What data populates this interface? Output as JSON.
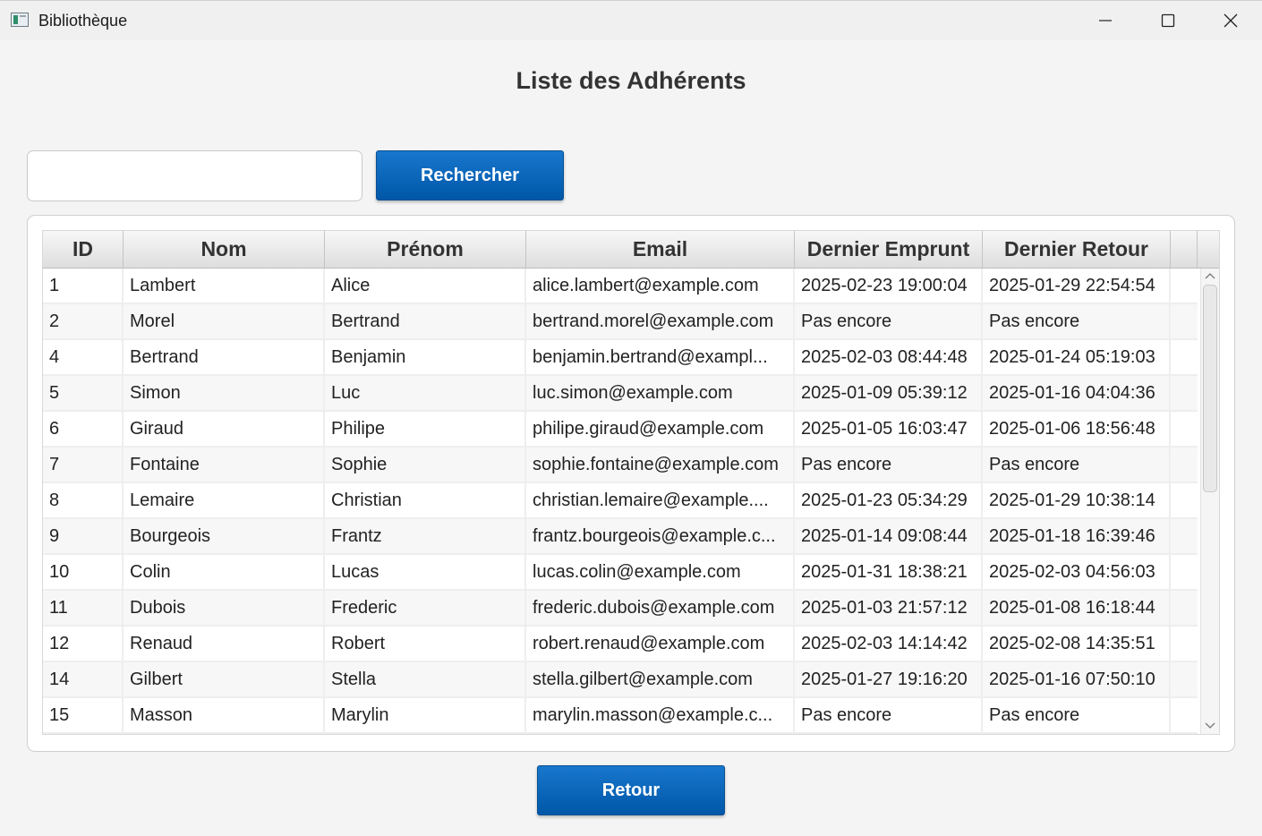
{
  "window": {
    "title": "Bibliothèque"
  },
  "page": {
    "heading": "Liste des Adhérents"
  },
  "search": {
    "value": "",
    "placeholder": "",
    "button_label": "Rechercher"
  },
  "table": {
    "columns": [
      "ID",
      "Nom",
      "Prénom",
      "Email",
      "Dernier Emprunt",
      "Dernier Retour"
    ],
    "rows": [
      [
        "1",
        "Lambert",
        "Alice",
        "alice.lambert@example.com",
        "2025-02-23 19:00:04",
        "2025-01-29 22:54:54"
      ],
      [
        "2",
        "Morel",
        "Bertrand",
        "bertrand.morel@example.com",
        "Pas encore",
        "Pas encore"
      ],
      [
        "4",
        "Bertrand",
        "Benjamin",
        "benjamin.bertrand@exampl...",
        "2025-02-03 08:44:48",
        "2025-01-24 05:19:03"
      ],
      [
        "5",
        "Simon",
        "Luc",
        "luc.simon@example.com",
        "2025-01-09 05:39:12",
        "2025-01-16 04:04:36"
      ],
      [
        "6",
        "Giraud",
        "Philipe",
        "philipe.giraud@example.com",
        "2025-01-05 16:03:47",
        "2025-01-06 18:56:48"
      ],
      [
        "7",
        "Fontaine",
        "Sophie",
        "sophie.fontaine@example.com",
        "Pas encore",
        "Pas encore"
      ],
      [
        "8",
        "Lemaire",
        "Christian",
        "christian.lemaire@example....",
        "2025-01-23 05:34:29",
        "2025-01-29 10:38:14"
      ],
      [
        "9",
        "Bourgeois",
        "Frantz",
        "frantz.bourgeois@example.c...",
        "2025-01-14 09:08:44",
        "2025-01-18 16:39:46"
      ],
      [
        "10",
        "Colin",
        "Lucas",
        "lucas.colin@example.com",
        "2025-01-31 18:38:21",
        "2025-02-03 04:56:03"
      ],
      [
        "11",
        "Dubois",
        "Frederic",
        "frederic.dubois@example.com",
        "2025-01-03 21:57:12",
        "2025-01-08 16:18:44"
      ],
      [
        "12",
        "Renaud",
        "Robert",
        "robert.renaud@example.com",
        "2025-02-03 14:14:42",
        "2025-02-08 14:35:51"
      ],
      [
        "14",
        "Gilbert",
        "Stella",
        "stella.gilbert@example.com",
        "2025-01-27 19:16:20",
        "2025-01-16 07:50:10"
      ],
      [
        "15",
        "Masson",
        "Marylin",
        "marylin.masson@example.c...",
        "Pas encore",
        "Pas encore"
      ]
    ]
  },
  "footer": {
    "back_label": "Retour"
  },
  "colors": {
    "accent": "#0a66c2",
    "window_bg": "#f4f4f4"
  },
  "icons": {
    "app": "app-window-icon",
    "minimize": "minimize-icon",
    "maximize": "maximize-icon",
    "close": "close-icon"
  }
}
